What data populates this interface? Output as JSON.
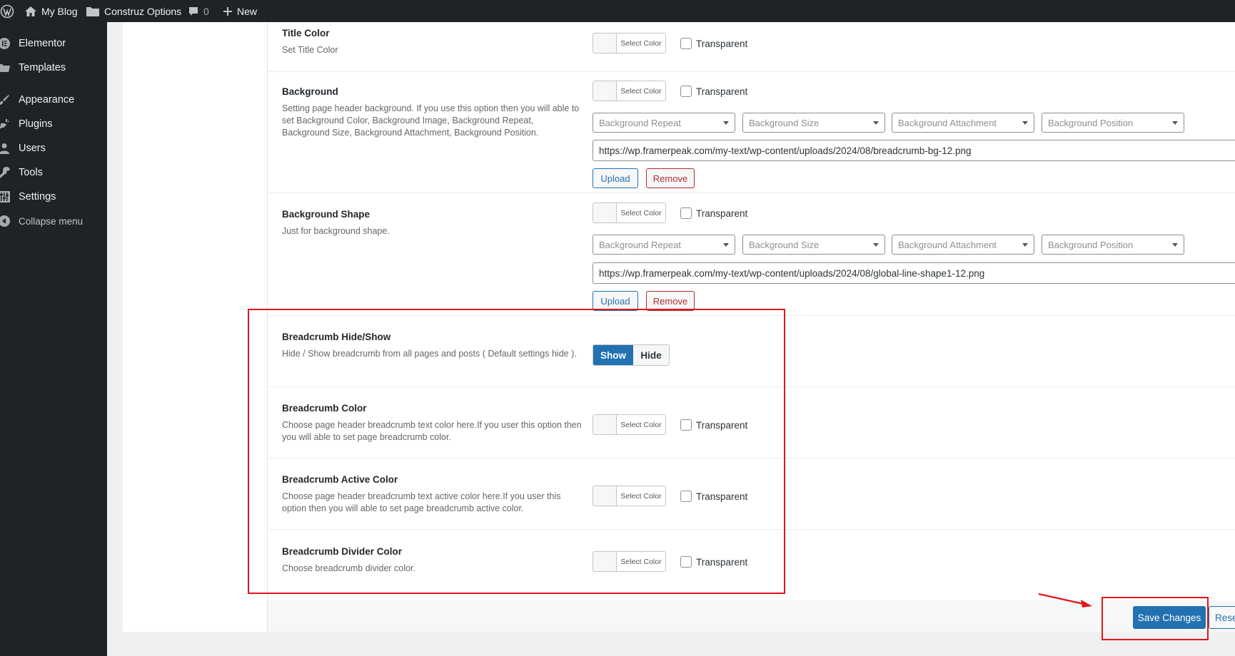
{
  "adminbar": {
    "site_name": "My Blog",
    "theme_options": "Construz Options",
    "comments_count": "0",
    "new_label": "New"
  },
  "sidebar": {
    "items": [
      {
        "label": "Elementor",
        "icon": "elementor-icon"
      },
      {
        "label": "Templates",
        "icon": "folder-icon"
      },
      {
        "label": "Appearance",
        "icon": "brush-icon"
      },
      {
        "label": "Plugins",
        "icon": "plug-icon"
      },
      {
        "label": "Users",
        "icon": "user-icon"
      },
      {
        "label": "Tools",
        "icon": "wrench-icon"
      },
      {
        "label": "Settings",
        "icon": "settings-icon"
      }
    ],
    "collapse_label": "Collapse menu"
  },
  "common": {
    "select_color": "Select Color",
    "transparent": "Transparent",
    "upload": "Upload",
    "remove": "Remove",
    "bg_repeat": "Background Repeat",
    "bg_size": "Background Size",
    "bg_attachment": "Background Attachment",
    "bg_position": "Background Position"
  },
  "sections": {
    "title_color": {
      "title": "Title Color",
      "desc": "Set Title Color"
    },
    "background": {
      "title": "Background",
      "desc": "Setting page header background. If you use this option then you will able to set Background Color, Background Image, Background Repeat, Background Size, Background Attachment, Background Position.",
      "url": "https://wp.framerpeak.com/my-text/wp-content/uploads/2024/08/breadcrumb-bg-12.png"
    },
    "background_shape": {
      "title": "Background Shape",
      "desc": "Just for background shape.",
      "url": "https://wp.framerpeak.com/my-text/wp-content/uploads/2024/08/global-line-shape1-12.png"
    },
    "breadcrumb_hide_show": {
      "title": "Breadcrumb Hide/Show",
      "desc": "Hide / Show breadcrumb from all pages and posts ( Default settings hide ).",
      "show_label": "Show",
      "hide_label": "Hide",
      "selected": "Show"
    },
    "breadcrumb_color": {
      "title": "Breadcrumb Color",
      "desc": "Choose page header breadcrumb text color here.If you user this option then you will able to set page breadcrumb color."
    },
    "breadcrumb_active_color": {
      "title": "Breadcrumb Active Color",
      "desc": "Choose page header breadcrumb text active color here.If you user this option then you will able to set page breadcrumb active color."
    },
    "breadcrumb_divider_color": {
      "title": "Breadcrumb Divider Color",
      "desc": "Choose breadcrumb divider color."
    }
  },
  "footer": {
    "save_label": "Save Changes",
    "reset_label": "Reset"
  },
  "colors": {
    "accent": "#2271b1",
    "annotation": "#e0161b",
    "sidebar_bg": "#1d2327"
  }
}
